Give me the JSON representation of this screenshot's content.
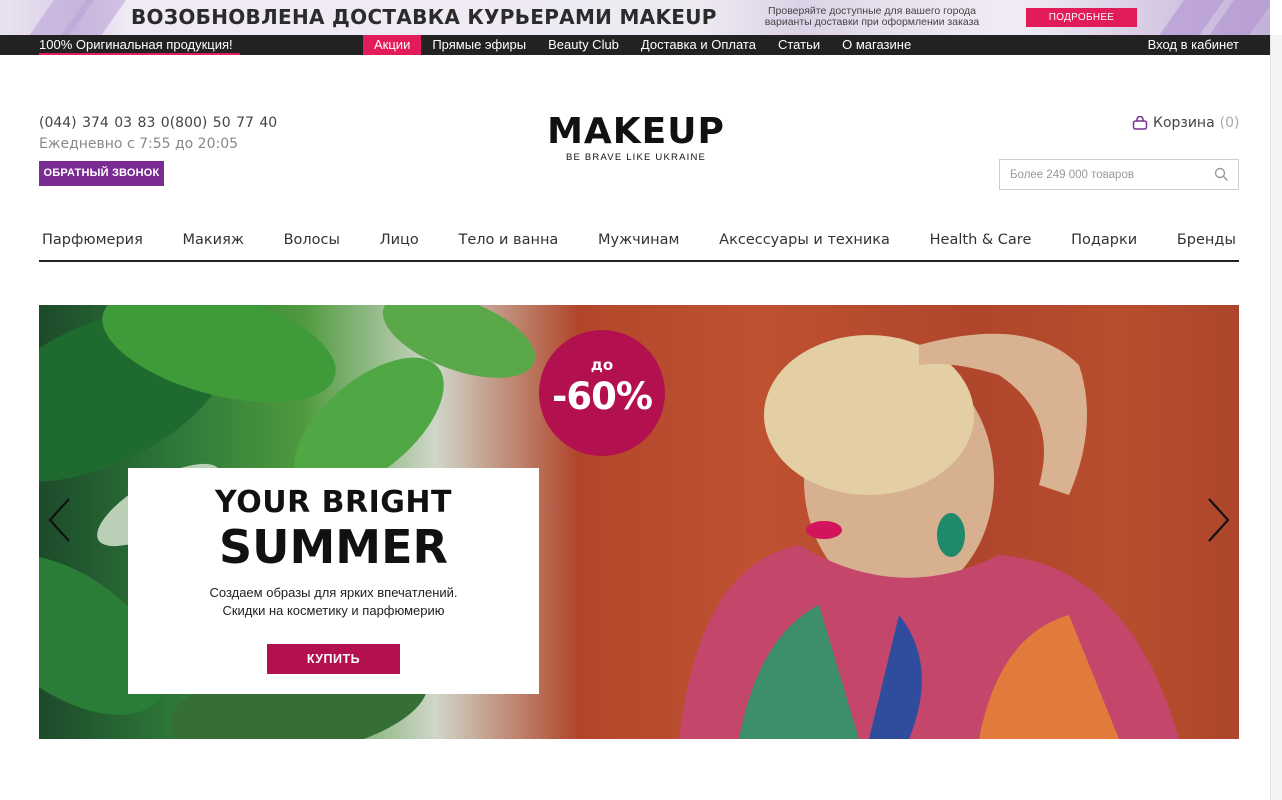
{
  "promo": {
    "title": "ВОЗОБНОВЛЕНА ДОСТАВКА КУРЬЕРАМИ MAKEUP",
    "note": "Проверяйте доступные для вашего города варианты доставки при оформлении заказа",
    "button": "ПОДРОБНЕЕ",
    "accent": "#e21b5a"
  },
  "topbar": {
    "original": "100% Оригинальная продукция!",
    "links": [
      "Акции",
      "Прямые эфиры",
      "Beauty Club",
      "Доставка и Оплата",
      "Статьи",
      "О магазине"
    ],
    "login": "Вход в кабинет"
  },
  "header": {
    "phones": "(044) 374 03 83  0(800) 50 77 40",
    "hours": "Ежедневно с 7:55 до 20:05",
    "callback": "ОБРАТНЫЙ ЗВОНОК",
    "logo": "MAKEUP",
    "tagline": "BE BRAVE LIKE UKRAINE",
    "cart_label": "Корзина",
    "cart_count": "(0)",
    "search_placeholder": "Более 249 000 товаров"
  },
  "categories": [
    "Парфюмерия",
    "Макияж",
    "Волосы",
    "Лицо",
    "Тело и ванна",
    "Мужчинам",
    "Аксессуары и техника",
    "Health & Care",
    "Подарки",
    "Бренды"
  ],
  "hero": {
    "badge_small": "до",
    "badge_big": "-60%",
    "title_line1": "YOUR BRIGHT",
    "title_line2": "SUMMER",
    "subtitle_line1": "Создаем образы для ярких впечатлений.",
    "subtitle_line2": "Скидки на косметику и парфюмерию",
    "cta": "КУПИТЬ",
    "brand_color": "#b3104f"
  },
  "icons": {
    "search": "magnifier-icon",
    "cart": "bag-icon",
    "prev": "chevron-left-icon",
    "next": "chevron-right-icon"
  }
}
